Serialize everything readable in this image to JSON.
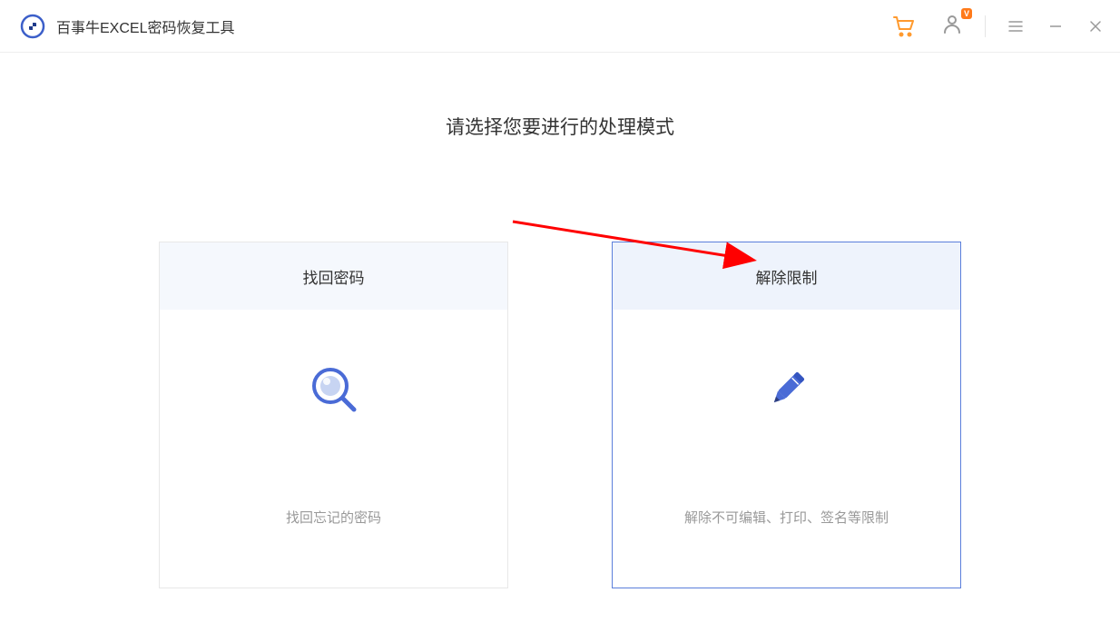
{
  "header": {
    "app_title": "百事牛EXCEL密码恢复工具",
    "vip_badge": "V"
  },
  "main": {
    "heading": "请选择您要进行的处理模式",
    "cards": [
      {
        "title": "找回密码",
        "description": "找回忘记的密码"
      },
      {
        "title": "解除限制",
        "description": "解除不可编辑、打印、签名等限制"
      }
    ]
  }
}
